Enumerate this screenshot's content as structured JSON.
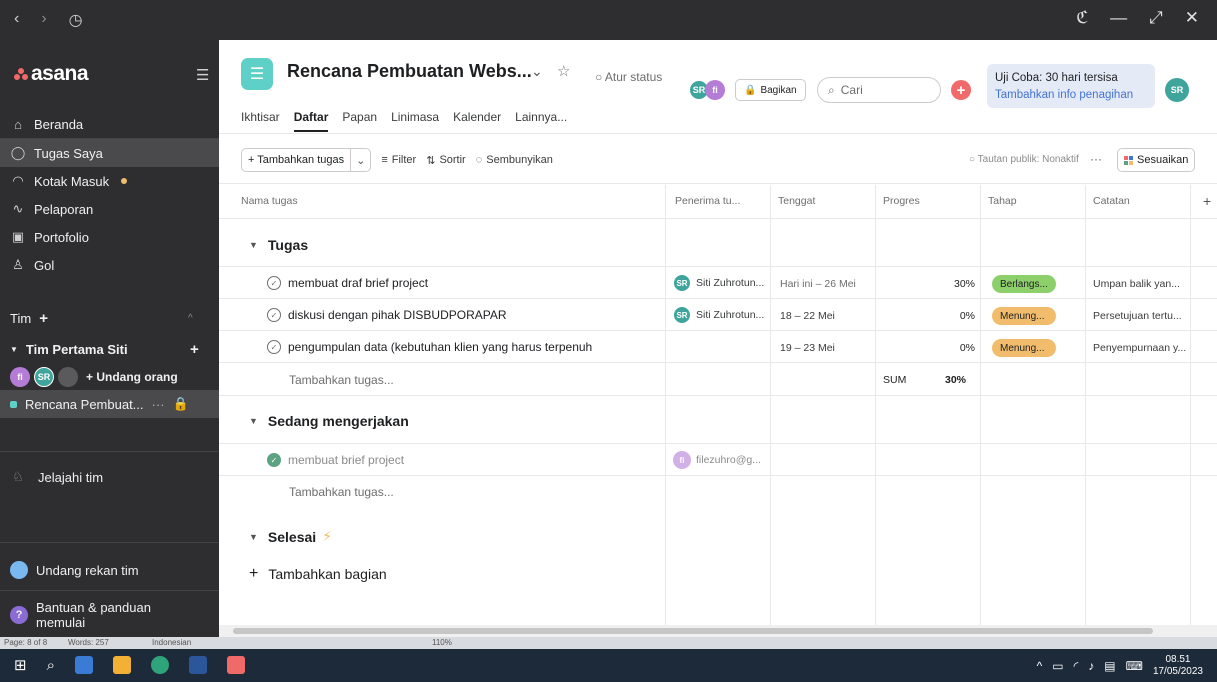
{
  "titlebar": {
    "back": "‹",
    "forward": "›",
    "history": "◷",
    "window_controls": [
      "ℭ",
      "—",
      "⤢",
      "✕"
    ]
  },
  "sidebar": {
    "logo": "asana",
    "collapse_icon": "☰",
    "nav": [
      {
        "label": "Beranda",
        "icon": "home-icon"
      },
      {
        "label": "Tugas Saya",
        "icon": "check-circle-icon"
      },
      {
        "label": "Kotak Masuk",
        "icon": "bell-icon"
      },
      {
        "label": "Pelaporan",
        "icon": "chart-line-icon"
      },
      {
        "label": "Portofolio",
        "icon": "portfolio-icon"
      },
      {
        "label": "Gol",
        "icon": "people-icon"
      }
    ],
    "team_header": "Tim",
    "team_add": "+",
    "team_name": "Tim Pertama Siti",
    "team_name_add": "+",
    "avatars": [
      "fi",
      "SR"
    ],
    "invite": "+ Undang orang",
    "project": "Rencana Pembuat...",
    "project_more": "···",
    "explore": "Jelajahi tim",
    "invite_teammate": "Undang rekan tim",
    "help": "Bantuan & panduan memulai"
  },
  "wordstrip": {
    "page": "Page: 8 of 8",
    "words": "Words: 257",
    "lang": "Indonesian",
    "zoom": "110%"
  },
  "header": {
    "title": "Rencana Pembuatan Webs...",
    "status": "○ Atur status",
    "avatars": [
      "SR",
      "fi"
    ],
    "share": "Bagikan",
    "search_placeholder": "Cari",
    "trial_line1": "Uji Coba: 30 hari tersisa",
    "trial_line2": "Tambahkan info penagihan",
    "user_initials": "SR"
  },
  "tabs": [
    "Ikhtisar",
    "Daftar",
    "Papan",
    "Linimasa",
    "Kalender",
    "Lainnya..."
  ],
  "toolbar": {
    "add_task": "+ Tambahkan tugas",
    "filter": "Filter",
    "sort": "Sortir",
    "hide": "Sembunyikan",
    "public_link": "○ Tautan publik: Nonaktif",
    "more": "···",
    "customize": "Sesuaikan"
  },
  "columns": [
    "Nama tugas",
    "Penerima tu...",
    "Tenggat",
    "Progres",
    "Tahap",
    "Catatan"
  ],
  "sections": [
    {
      "name": "Tugas",
      "tasks": [
        {
          "name": "membuat draf brief project",
          "assignee": "Siti Zuhrotun...",
          "assignee_initials": "SR",
          "due": "Hari ini – 26 Mei",
          "progress": "30%",
          "stage": "Berlangs...",
          "stage_color": "#8ccf6b",
          "note": "Umpan balik yan..."
        },
        {
          "name": "diskusi dengan pihak DISBUDPORAPAR",
          "assignee": "Siti Zuhrotun...",
          "assignee_initials": "SR",
          "due": "18 – 22 Mei",
          "progress": "0%",
          "stage": "Menung...",
          "stage_color": "#f1bd6c",
          "note": "Persetujuan tertu..."
        },
        {
          "name": "pengumpulan data (kebutuhan klien yang harus terpenuh",
          "assignee": "",
          "assignee_initials": "",
          "due": "19 – 23 Mei",
          "progress": "0%",
          "stage": "Menung...",
          "stage_color": "#f1bd6c",
          "note": "Penyempurnaan y..."
        }
      ],
      "add_task": "Tambahkan tugas...",
      "sum_label": "SUM",
      "sum_value": "30%"
    },
    {
      "name": "Sedang mengerjakan",
      "tasks": [
        {
          "name": "membuat brief project",
          "assignee": "filezuhro@g...",
          "assignee_initials": "fi",
          "done": true
        }
      ],
      "add_task": "Tambahkan tugas..."
    },
    {
      "name": "Selesai",
      "emoji": "⚡"
    }
  ],
  "add_section": "Tambahkan bagian",
  "add_column": "+",
  "taskbar": {
    "time": "08.51",
    "date": "17/05/2023"
  }
}
